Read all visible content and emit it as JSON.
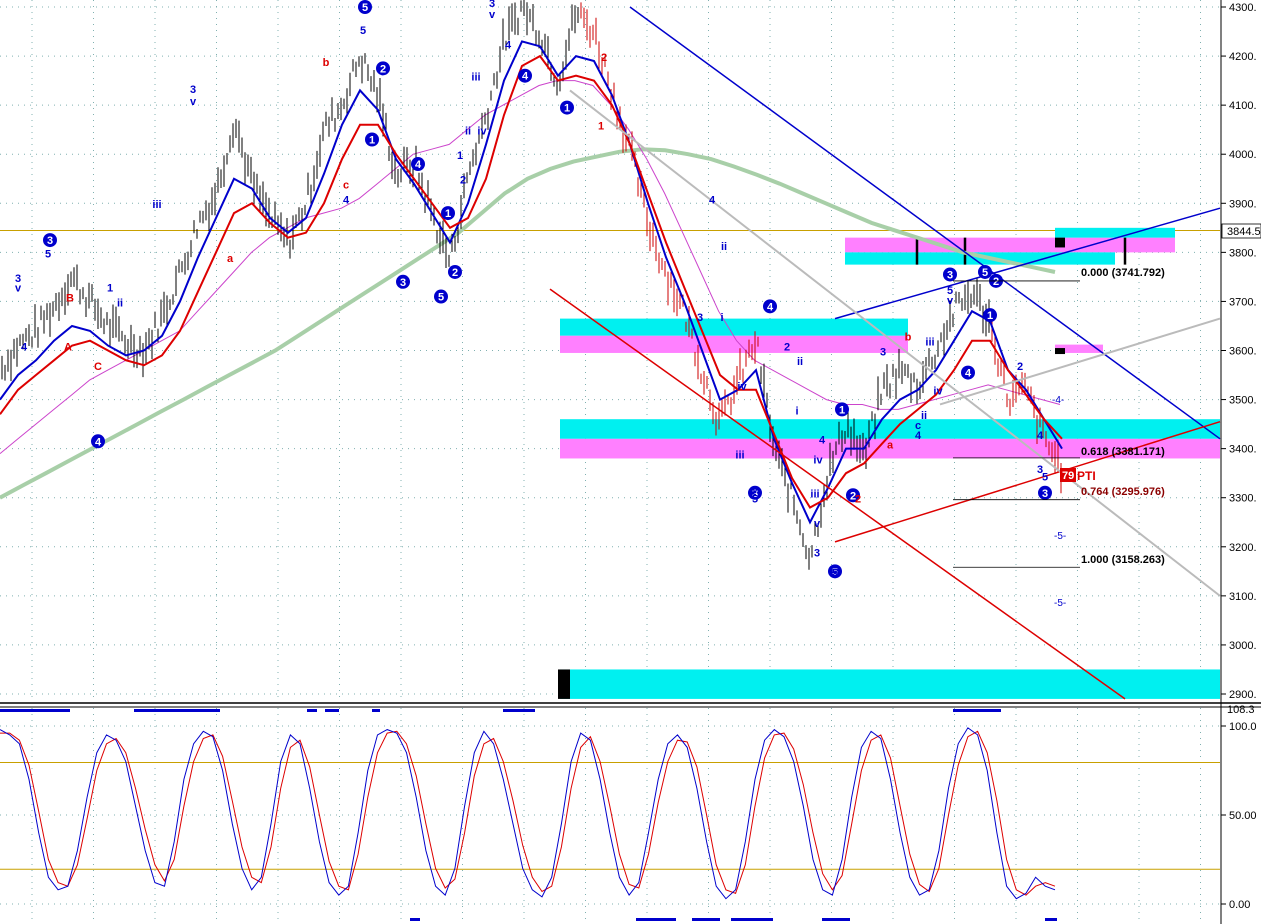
{
  "colors": {
    "price_bar": "#000000",
    "blue_band": "#0000cc",
    "red_band": "#dd0000",
    "magenta_ma": "#cc44cc",
    "green_ma": "#a8cfa8",
    "grey_channel": "#bbbbbb",
    "cyan_zone": "#00f0f0",
    "magenta_zone": "#ff80ff",
    "gold_line": "#c8a000",
    "grid": "#80b0b0",
    "wave_blue": "#0000cc",
    "wave_red": "#dd0000"
  },
  "main_axis": {
    "ticks": [
      "4300.",
      "4200.",
      "4100.",
      "4000.",
      "3900.",
      "3800.",
      "3700.",
      "3600.",
      "3500.",
      "3400.",
      "3300.",
      "3200.",
      "3100.",
      "3000.",
      "2900."
    ],
    "last_price_label": "3844.5",
    "last_price_value": 3844.5
  },
  "osc_axis": {
    "ticks": [
      "100.0",
      "50.00",
      "0.00"
    ],
    "top_label": "108.3"
  },
  "fib_levels": [
    {
      "label": "0.000 (3741.792)",
      "value": 3741.792
    },
    {
      "label": "0.618 (3381.171)",
      "value": 3381.171
    },
    {
      "label": "0.764 (3295.976)",
      "value": 3295.976
    },
    {
      "label": "1.000 (3158.263)",
      "value": 3158.263
    }
  ],
  "annotations": {
    "pti_number": "79",
    "pti_text": "PTI",
    "proj_labels": [
      "-5-",
      "-5-",
      "-4-"
    ]
  },
  "chart_data": [
    {
      "type": "line",
      "title": "",
      "ylim": [
        2890,
        4310
      ],
      "ticks": [
        4300,
        4200,
        4100,
        4000,
        3900,
        3800,
        3700,
        3600,
        3500,
        3400,
        3300,
        3200,
        3100,
        3000,
        2900
      ],
      "series": [
        {
          "values": [
            3560,
            3610,
            3640,
            3690,
            3750,
            3700,
            3650,
            3620,
            3600,
            3670,
            3760,
            3860,
            3920,
            4070,
            3940,
            3870,
            3820,
            3900,
            4050,
            4100,
            4200,
            4120,
            3960,
            3980,
            3880,
            3780,
            3960,
            4080,
            4230,
            4300,
            4250,
            4150,
            4290,
            4250,
            4130,
            4010,
            3860,
            3760,
            3680,
            3560,
            3450,
            3540,
            3620,
            3400,
            3300,
            3180,
            3350,
            3450,
            3380,
            3520,
            3560,
            3530,
            3600,
            3680,
            3720,
            3660,
            3500,
            3520,
            3420,
            3360
          ]
        },
        {
          "values": [
            3500,
            3550,
            3580,
            3620,
            3650,
            3640,
            3610,
            3590,
            3600,
            3630,
            3700,
            3790,
            3870,
            3950,
            3930,
            3870,
            3840,
            3870,
            3960,
            4060,
            4130,
            4090,
            3990,
            3940,
            3880,
            3820,
            3900,
            4020,
            4150,
            4230,
            4220,
            4160,
            4200,
            4190,
            4120,
            4020,
            3900,
            3790,
            3700,
            3600,
            3500,
            3520,
            3560,
            3420,
            3330,
            3250,
            3320,
            3400,
            3400,
            3460,
            3500,
            3520,
            3560,
            3620,
            3680,
            3660,
            3560,
            3520,
            3460,
            3400
          ]
        },
        {
          "values": [
            3470,
            3520,
            3550,
            3580,
            3610,
            3620,
            3600,
            3580,
            3570,
            3590,
            3640,
            3720,
            3800,
            3880,
            3900,
            3860,
            3830,
            3840,
            3900,
            3990,
            4060,
            4060,
            4000,
            3950,
            3900,
            3850,
            3870,
            3950,
            4080,
            4180,
            4200,
            4150,
            4160,
            4150,
            4100,
            4020,
            3920,
            3820,
            3730,
            3640,
            3550,
            3520,
            3520,
            3430,
            3340,
            3280,
            3300,
            3350,
            3370,
            3410,
            3450,
            3480,
            3510,
            3560,
            3620,
            3620,
            3560,
            3510,
            3460,
            3420
          ]
        },
        {
          "values": [
            3390,
            3420,
            3450,
            3480,
            3510,
            3540,
            3560,
            3580,
            3600,
            3620,
            3640,
            3680,
            3720,
            3760,
            3800,
            3830,
            3850,
            3870,
            3880,
            3890,
            3910,
            3940,
            3970,
            4000,
            4010,
            4020,
            4050,
            4080,
            4100,
            4120,
            4140,
            4150,
            4150,
            4140,
            4100,
            4050,
            3990,
            3920,
            3840,
            3760,
            3680,
            3620,
            3580,
            3560,
            3540,
            3520,
            3500,
            3490,
            3490,
            3480,
            3480,
            3490,
            3500,
            3510,
            3520,
            3530,
            3520,
            3510,
            3500,
            3490
          ]
        },
        {
          "values": [
            3300,
            3325,
            3350,
            3375,
            3400,
            3425,
            3450,
            3475,
            3500,
            3525,
            3550,
            3575,
            3600,
            3630,
            3660,
            3690,
            3720,
            3750,
            3780,
            3810,
            3840,
            3880,
            3920,
            3950,
            3970,
            3985,
            3995,
            4005,
            4010,
            4008,
            4000,
            3990,
            3975,
            3958,
            3940,
            3920,
            3900,
            3880,
            3860,
            3845,
            3830,
            3815,
            3800,
            3790,
            3780,
            3770,
            3760
          ]
        }
      ]
    },
    {
      "type": "line",
      "title": "",
      "ylim": [
        0,
        108.3
      ],
      "ticks": [
        100,
        50,
        0
      ],
      "series": [
        {
          "values": [
            98,
            95,
            90,
            70,
            40,
            15,
            8,
            10,
            30,
            60,
            85,
            95,
            92,
            80,
            55,
            30,
            12,
            10,
            35,
            70,
            90,
            97,
            94,
            75,
            45,
            20,
            8,
            15,
            45,
            80,
            95,
            90,
            65,
            35,
            12,
            5,
            10,
            40,
            75,
            95,
            98,
            96,
            85,
            60,
            30,
            10,
            5,
            20,
            55,
            85,
            97,
            90,
            70,
            45,
            20,
            8,
            4,
            15,
            45,
            80,
            96,
            92,
            70,
            40,
            15,
            5,
            12,
            40,
            70,
            90,
            95,
            88,
            65,
            35,
            10,
            3,
            8,
            35,
            70,
            92,
            98,
            94,
            80,
            55,
            25,
            8,
            5,
            25,
            60,
            88,
            97,
            93,
            70,
            40,
            15,
            5,
            8,
            30,
            65,
            90,
            99,
            95,
            75,
            40,
            10,
            3,
            6,
            15,
            10,
            8
          ]
        },
        {
          "values": [
            96,
            96,
            92,
            78,
            52,
            25,
            12,
            10,
            22,
            48,
            75,
            90,
            93,
            85,
            65,
            42,
            22,
            13,
            25,
            55,
            80,
            93,
            95,
            83,
            58,
            32,
            15,
            12,
            32,
            65,
            88,
            92,
            77,
            50,
            24,
            10,
            8,
            28,
            60,
            85,
            96,
            97,
            90,
            72,
            45,
            20,
            9,
            14,
            40,
            72,
            90,
            93,
            80,
            58,
            33,
            15,
            7,
            10,
            32,
            65,
            88,
            94,
            80,
            55,
            28,
            11,
            9,
            28,
            57,
            80,
            92,
            91,
            77,
            50,
            22,
            8,
            6,
            22,
            55,
            82,
            95,
            96,
            87,
            67,
            40,
            17,
            8,
            16,
            45,
            75,
            92,
            95,
            82,
            55,
            28,
            11,
            7,
            20,
            50,
            78,
            94,
            97,
            85,
            58,
            25,
            8,
            5,
            10,
            12,
            10
          ]
        }
      ]
    }
  ]
}
